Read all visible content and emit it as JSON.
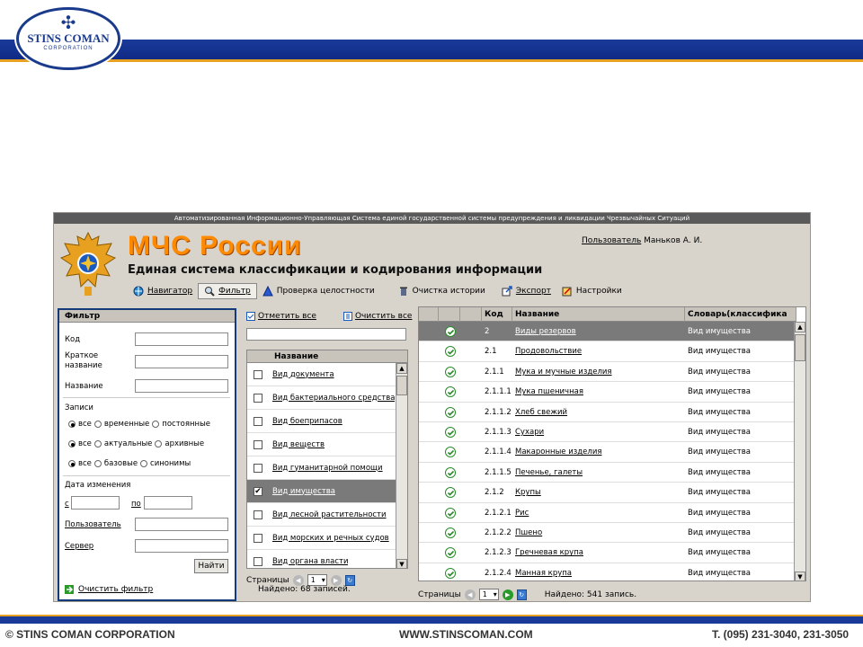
{
  "slide": {
    "logo_name": "STINS COMAN",
    "logo_sub": "CORPORATION",
    "footer_left": "© STINS COMAN CORPORATION",
    "footer_mid": "WWW.STINSCOMAN.COM",
    "footer_right": "T. (095) 231-3040, 231-3050"
  },
  "app": {
    "title_bar": "Автоматизированная Информационно-Управляющая Система единой государственной системы предупреждения и ликвидации Чрезвычайных Ситуаций",
    "brand": "МЧС России",
    "subtitle": "Единая система классификации и кодирования информации",
    "user_label": "Пользователь",
    "user_name": "Маньков А. И.",
    "toolbar": {
      "navigator": "Навигатор",
      "filter": "Фильтр",
      "integrity": "Проверка целостности",
      "clear_history": "Очистка истории",
      "export": "Экспорт",
      "settings": "Настройки"
    }
  },
  "filter": {
    "title": "Фильтр",
    "code_label": "Код",
    "short_name_label": "Краткое название",
    "name_label": "Название",
    "records_label": "Записи",
    "row1": [
      "все",
      "временные",
      "постоянные"
    ],
    "row2": [
      "все",
      "актуальные",
      "архивные"
    ],
    "row3": [
      "все",
      "базовые",
      "синонимы"
    ],
    "date_label": "Дата изменения",
    "from_label": "с",
    "to_label": "по",
    "user_label": "Пользователь",
    "server_label": "Сервер",
    "find_button": "Найти",
    "clear_filter": "Очистить фильтр"
  },
  "middle": {
    "mark_all": "Отметить все",
    "clear_all": "Очистить все",
    "column": "Название",
    "items": [
      {
        "label": "Вид документа",
        "checked": false
      },
      {
        "label": "Вид бактериального средства",
        "checked": false
      },
      {
        "label": "Вид боеприпасов",
        "checked": false
      },
      {
        "label": "Вид веществ",
        "checked": false
      },
      {
        "label": "Вид гуманитарной помощи",
        "checked": false
      },
      {
        "label": "Вид имущества",
        "checked": true
      },
      {
        "label": "Вид лесной растительности",
        "checked": false
      },
      {
        "label": "Вид морских и речных судов",
        "checked": false
      },
      {
        "label": "Вид органа власти",
        "checked": false
      }
    ],
    "pages_label": "Страницы",
    "page": "1",
    "found": "Найдено: 68 записей."
  },
  "grid": {
    "columns": [
      "Код",
      "Название",
      "Словарь(классифика"
    ],
    "rows": [
      {
        "code": "2",
        "name": "Виды резервов",
        "dict": "Вид имущества"
      },
      {
        "code": "2.1",
        "name": "Продовольствие",
        "dict": "Вид имущества"
      },
      {
        "code": "2.1.1",
        "name": "Мука и мучные изделия",
        "dict": "Вид имущества"
      },
      {
        "code": "2.1.1.1",
        "name": "Мука пшеничная",
        "dict": "Вид имущества"
      },
      {
        "code": "2.1.1.2",
        "name": "Хлеб свежий",
        "dict": "Вид имущества"
      },
      {
        "code": "2.1.1.3",
        "name": "Сухари",
        "dict": "Вид имущества"
      },
      {
        "code": "2.1.1.4",
        "name": "Макаронные изделия",
        "dict": "Вид имущества"
      },
      {
        "code": "2.1.1.5",
        "name": "Печенье, галеты",
        "dict": "Вид имущества"
      },
      {
        "code": "2.1.2",
        "name": "Крупы",
        "dict": "Вид имущества"
      },
      {
        "code": "2.1.2.1",
        "name": "Рис",
        "dict": "Вид имущества"
      },
      {
        "code": "2.1.2.2",
        "name": "Пшено",
        "dict": "Вид имущества"
      },
      {
        "code": "2.1.2.3",
        "name": "Гречневая крупа",
        "dict": "Вид имущества"
      },
      {
        "code": "2.1.2.4",
        "name": "Манная крупа",
        "dict": "Вид имущества"
      }
    ],
    "pages_label": "Страницы",
    "page": "1",
    "found": "Найдено: 541 запись."
  },
  "colors": {
    "brand_orange": "#ff8a00",
    "header_blue": "#1a3a9a",
    "accent_gold": "#e8a020",
    "selection_gray": "#7a7a7a"
  }
}
